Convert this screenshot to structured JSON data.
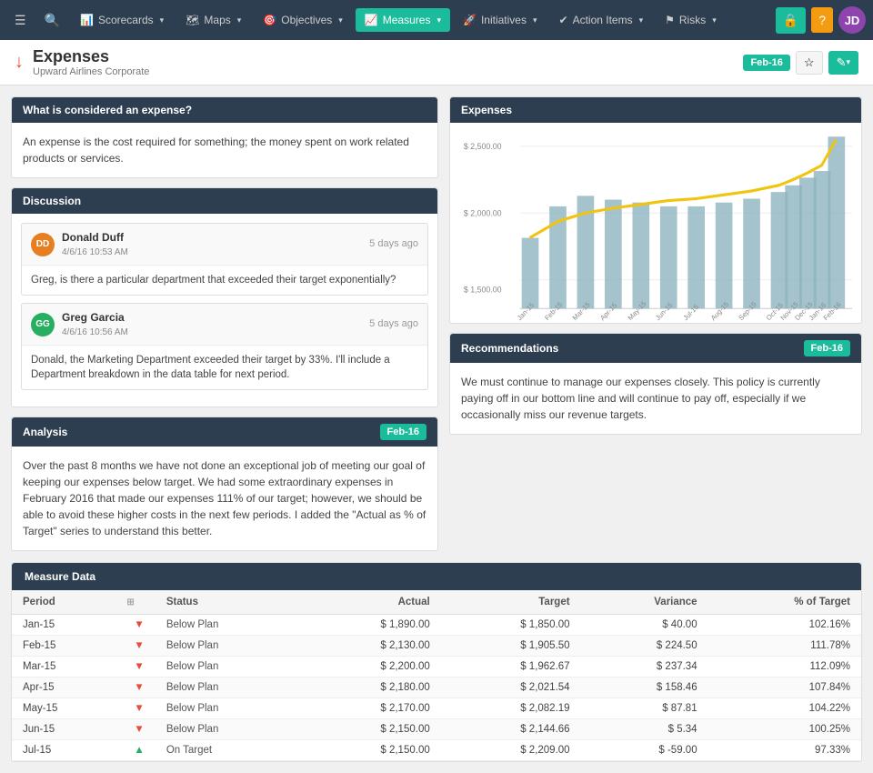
{
  "navbar": {
    "menu_icon": "☰",
    "search_icon": "🔍",
    "items": [
      {
        "id": "scorecards",
        "label": "Scorecards",
        "icon": "📊",
        "active": false
      },
      {
        "id": "maps",
        "label": "Maps",
        "icon": "🗺",
        "active": false
      },
      {
        "id": "objectives",
        "label": "Objectives",
        "icon": "🎯",
        "active": false
      },
      {
        "id": "measures",
        "label": "Measures",
        "icon": "📈",
        "active": true
      },
      {
        "id": "initiatives",
        "label": "Initiatives",
        "icon": "🚀",
        "active": false
      },
      {
        "id": "action-items",
        "label": "Action Items",
        "icon": "✔",
        "active": false
      },
      {
        "id": "risks",
        "label": "Risks",
        "icon": "⚑",
        "active": false
      }
    ],
    "right_icons": {
      "lock": "🔒",
      "question": "?",
      "avatar_initials": "JD"
    }
  },
  "page_header": {
    "title": "Expenses",
    "subtitle": "Upward Airlines Corporate",
    "date_badge": "Feb-16",
    "star_icon": "★",
    "edit_icon": "✎"
  },
  "what_is_expense": {
    "header": "What is considered an expense?",
    "body": "An expense is the cost required for something; the money spent on work related products or services."
  },
  "discussion": {
    "header": "Discussion",
    "items": [
      {
        "initials": "DD",
        "bg_color": "#e67e22",
        "name": "Donald Duff",
        "date": "4/6/16 10:53 AM",
        "ago": "5 days ago",
        "body": "Greg, is there a particular department that exceeded their target exponentially?"
      },
      {
        "initials": "GG",
        "bg_color": "#27ae60",
        "name": "Greg Garcia",
        "date": "4/6/16 10:56 AM",
        "ago": "5 days ago",
        "body": "Donald, the Marketing Department exceeded their target by 33%. I'll include a Department breakdown in the data table for next period."
      }
    ]
  },
  "analysis": {
    "header": "Analysis",
    "date_badge": "Feb-16",
    "body": "Over the past 8 months we have not done an exceptional job of meeting our goal of keeping our expenses below target. We had some extraordinary expenses in February 2016 that made our expenses 111% of our target; however, we should be able to avoid these higher costs in the next few periods. I added the \"Actual as % of Target\" series to understand this better."
  },
  "chart": {
    "header": "Expenses",
    "y_labels": [
      "$ 2,500.00",
      "$ 2,000.00",
      "$ 1,500.00"
    ],
    "x_labels": [
      "Jan-15",
      "Feb-15",
      "Mar-15",
      "Apr-15",
      "May-15",
      "Jun-15",
      "Jul-15",
      "Aug-15",
      "Sep-15",
      "Oct-15",
      "Nov-15",
      "Dec-15",
      "Jan-16",
      "Feb-16"
    ],
    "bars": [
      1890,
      2130,
      2200,
      2180,
      2170,
      2150,
      2150,
      2170,
      2190,
      2220,
      2250,
      2280,
      2310,
      2560
    ],
    "trend_line": [
      1890,
      1950,
      2000,
      2050,
      2080,
      2100,
      2120,
      2150,
      2170,
      2190,
      2220,
      2280,
      2350,
      2520
    ]
  },
  "recommendations": {
    "header": "Recommendations",
    "date_badge": "Feb-16",
    "body": "We must continue to manage our expenses closely. This policy is currently paying off in our bottom line and will continue to pay off, especially if we occasionally miss our revenue targets."
  },
  "table": {
    "header": "Measure Data",
    "columns": [
      "Period",
      "",
      "Status",
      "Actual",
      "Target",
      "Variance",
      "% of Target"
    ],
    "rows": [
      {
        "period": "Jan-15",
        "status_type": "down",
        "status": "Below Plan",
        "actual": "$ 1,890.00",
        "target": "$ 1,850.00",
        "variance": "$ 40.00",
        "pct": "102.16%"
      },
      {
        "period": "Feb-15",
        "status_type": "down",
        "status": "Below Plan",
        "actual": "$ 2,130.00",
        "target": "$ 1,905.50",
        "variance": "$ 224.50",
        "pct": "111.78%"
      },
      {
        "period": "Mar-15",
        "status_type": "down",
        "status": "Below Plan",
        "actual": "$ 2,200.00",
        "target": "$ 1,962.67",
        "variance": "$ 237.34",
        "pct": "112.09%"
      },
      {
        "period": "Apr-15",
        "status_type": "down",
        "status": "Below Plan",
        "actual": "$ 2,180.00",
        "target": "$ 2,021.54",
        "variance": "$ 158.46",
        "pct": "107.84%"
      },
      {
        "period": "May-15",
        "status_type": "down",
        "status": "Below Plan",
        "actual": "$ 2,170.00",
        "target": "$ 2,082.19",
        "variance": "$ 87.81",
        "pct": "104.22%"
      },
      {
        "period": "Jun-15",
        "status_type": "down",
        "status": "Below Plan",
        "actual": "$ 2,150.00",
        "target": "$ 2,144.66",
        "variance": "$ 5.34",
        "pct": "100.25%"
      },
      {
        "period": "Jul-15",
        "status_type": "up",
        "status": "On Target",
        "actual": "$ 2,150.00",
        "target": "$ 2,209.00",
        "variance": "$ -59.00",
        "pct": "97.33%"
      }
    ]
  }
}
